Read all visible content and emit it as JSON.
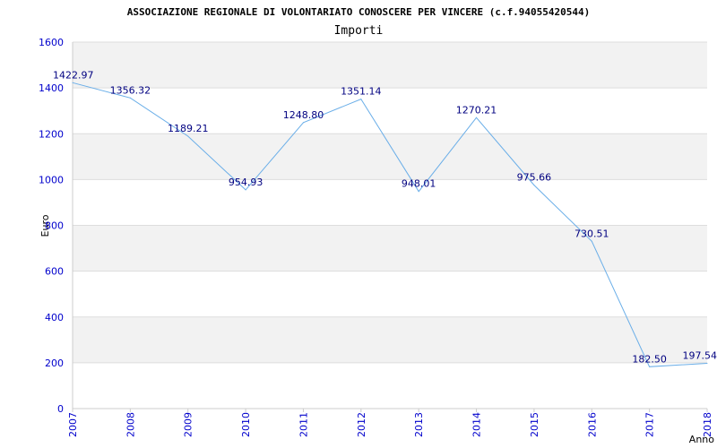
{
  "chart_data": {
    "type": "line",
    "title": "ASSOCIAZIONE REGIONALE DI VOLONTARIATO CONOSCERE PER VINCERE (c.f.94055420544)",
    "subtitle": "Importi",
    "xlabel": "Anno",
    "ylabel": "Euro",
    "ylim": [
      0,
      1600
    ],
    "yticks": [
      "0",
      "200",
      "400",
      "600",
      "800",
      "1000",
      "1200",
      "1400",
      "1600"
    ],
    "categories": [
      "2007",
      "2008",
      "2009",
      "2010",
      "2011",
      "2012",
      "2013",
      "2014",
      "2015",
      "2016",
      "2017",
      "2018"
    ],
    "values": [
      1422.97,
      1356.32,
      1189.21,
      954.93,
      1248.8,
      1351.14,
      948.01,
      1270.21,
      975.66,
      730.51,
      182.5,
      197.54
    ],
    "value_labels": [
      "1422.97",
      "1356.32",
      "1189.21",
      "954.93",
      "1248.80",
      "1351.14",
      "948.01",
      "1270.21",
      "975.66",
      "730.51",
      "182.50",
      "197.54"
    ],
    "grid": true,
    "colors": {
      "line": "#6aaee8",
      "band": "#f2f2f2",
      "gridline": "#dddddd",
      "axis": "#cccccc",
      "tick_text": "#0000cc",
      "data_label": "#000080"
    }
  }
}
